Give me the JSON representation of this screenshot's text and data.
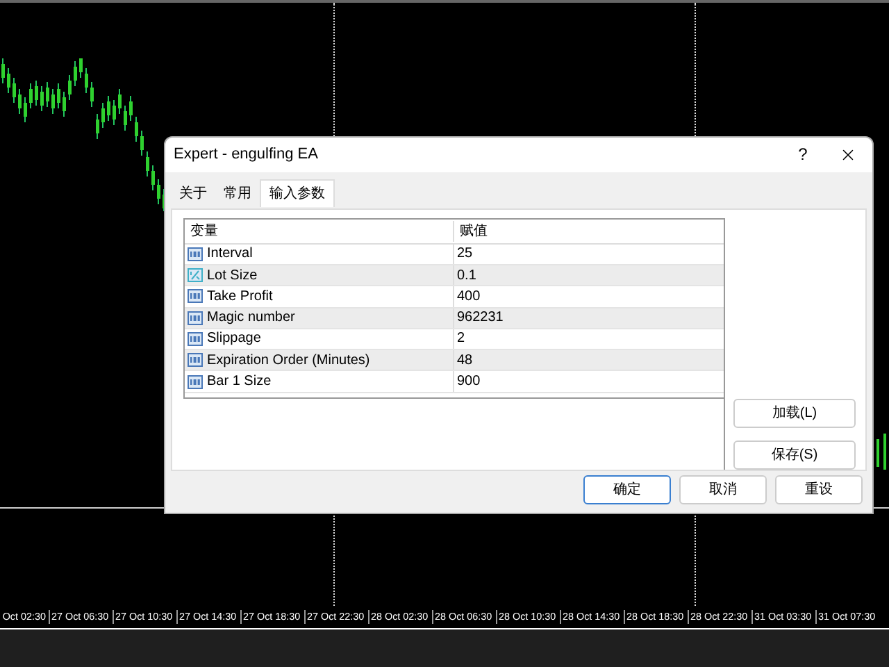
{
  "chart": {
    "time_labels": [
      "Oct 02:30",
      "27 Oct 06:30",
      "27 Oct 10:30",
      "27 Oct 14:30",
      "27 Oct 18:30",
      "27 Oct 22:30",
      "28 Oct 02:30",
      "28 Oct 06:30",
      "28 Oct 10:30",
      "28 Oct 14:30",
      "28 Oct 18:30",
      "28 Oct 22:30",
      "31 Oct 03:30",
      "31 Oct 07:30"
    ]
  },
  "dialog": {
    "title": "Expert - engulfing EA",
    "help": "?",
    "tabs": [
      {
        "label": "关于",
        "selected": false
      },
      {
        "label": "常用",
        "selected": false
      },
      {
        "label": "输入参数",
        "selected": true
      }
    ],
    "table": {
      "columns": [
        "变量",
        "赋值"
      ],
      "rows": [
        {
          "kind": "int",
          "name": "Interval",
          "value": "25"
        },
        {
          "kind": "double",
          "name": "Lot Size",
          "value": "0.1"
        },
        {
          "kind": "int",
          "name": "Take Profit",
          "value": "400"
        },
        {
          "kind": "int",
          "name": "Magic number",
          "value": "962231"
        },
        {
          "kind": "int",
          "name": "Slippage",
          "value": "2"
        },
        {
          "kind": "int",
          "name": "Expiration Order (Minutes)",
          "value": "48"
        },
        {
          "kind": "int",
          "name": "Bar 1 Size",
          "value": "900"
        }
      ]
    },
    "side_buttons": [
      "加载(L)",
      "保存(S)"
    ],
    "buttons": [
      {
        "label": "确定",
        "default": true
      },
      {
        "label": "取消",
        "default": false
      },
      {
        "label": "重设",
        "default": false
      }
    ]
  }
}
